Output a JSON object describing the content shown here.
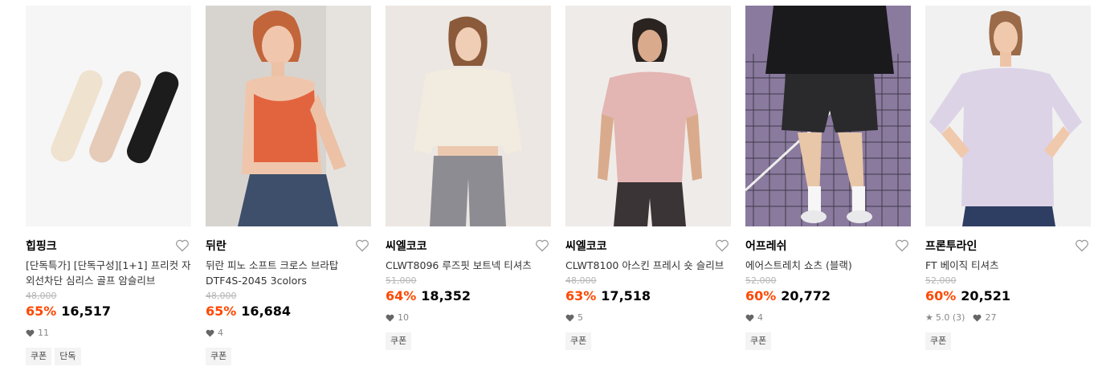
{
  "colors": {
    "discount": "#ff4800",
    "tag_bg": "#f4f4f4"
  },
  "products": [
    {
      "brand": "힙핑크",
      "name": "[단독특가] [단독구성][1+1] 프리컷 자외선차단 심리스 골프 암슬리브",
      "original_price": "48,000",
      "discount": "65%",
      "price": "16,517",
      "rating": "",
      "reviews": "",
      "likes": "11",
      "tags": [
        "쿠폰",
        "단독"
      ]
    },
    {
      "brand": "뒤란",
      "name": "뒤란 피노 소프트 크로스 브라탑 DTF4S-2045 3colors",
      "original_price": "48,000",
      "discount": "65%",
      "price": "16,684",
      "rating": "",
      "reviews": "",
      "likes": "4",
      "tags": [
        "쿠폰"
      ]
    },
    {
      "brand": "씨엘코코",
      "name": "CLWT8096 루즈핏 보트넥 티셔츠",
      "original_price": "51,000",
      "discount": "64%",
      "price": "18,352",
      "rating": "",
      "reviews": "",
      "likes": "10",
      "tags": [
        "쿠폰"
      ]
    },
    {
      "brand": "씨엘코코",
      "name": "CLWT8100 아스킨 프레시 숏 슬리브",
      "original_price": "48,000",
      "discount": "63%",
      "price": "17,518",
      "rating": "",
      "reviews": "",
      "likes": "5",
      "tags": [
        "쿠폰"
      ]
    },
    {
      "brand": "어프레쉬",
      "name": "에어스트레치 쇼츠 (블랙)",
      "original_price": "52,000",
      "discount": "60%",
      "price": "20,772",
      "rating": "",
      "reviews": "",
      "likes": "4",
      "tags": [
        "쿠폰"
      ]
    },
    {
      "brand": "프론투라인",
      "name": "FT 베이직 티셔츠",
      "original_price": "52,000",
      "discount": "60%",
      "price": "20,521",
      "rating": "5.0",
      "reviews": "(3)",
      "likes": "27",
      "tags": [
        "쿠폰"
      ]
    }
  ]
}
